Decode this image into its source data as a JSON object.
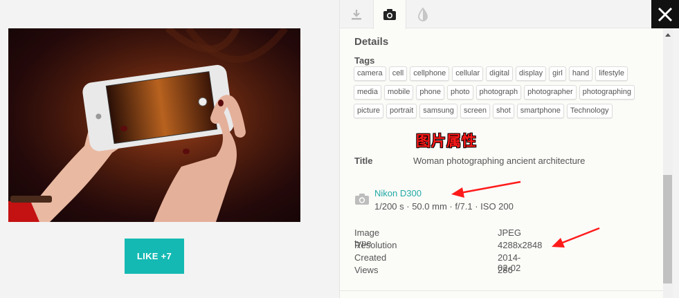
{
  "like_button": {
    "label": "LIKE +7"
  },
  "tabs": [
    {
      "name": "download",
      "icon": "download-icon"
    },
    {
      "name": "camera-info",
      "icon": "camera-icon",
      "active": true
    },
    {
      "name": "adjust",
      "icon": "contrast-drop-icon"
    }
  ],
  "details": {
    "heading": "Details",
    "tags_label": "Tags",
    "tags": [
      "camera",
      "cell",
      "cellphone",
      "cellular",
      "digital",
      "display",
      "girl",
      "hand",
      "lifestyle",
      "media",
      "mobile",
      "phone",
      "photo",
      "photograph",
      "photographer",
      "photographing",
      "picture",
      "portrait",
      "samsung",
      "screen",
      "shot",
      "smartphone",
      "Technology"
    ],
    "title_label": "Title",
    "title_value": "Woman photographing ancient architecture"
  },
  "annotation": {
    "text": "图片属性",
    "color": "#ff1a1a"
  },
  "camera": {
    "model": "Nikon D300",
    "settings": "1/200 s · 50.0 mm · f/7.1 · ISO 200"
  },
  "meta": [
    {
      "key": "Image type",
      "value": "JPEG"
    },
    {
      "key": "Resolution",
      "value": "4288x2848"
    },
    {
      "key": "Created",
      "value": "2014-02-02"
    },
    {
      "key": "Views",
      "value": "286"
    }
  ],
  "colors": {
    "accent": "#14b9b3",
    "link": "#21a9a5",
    "close_bg": "#111111",
    "arrow": "#ff1a1a"
  }
}
